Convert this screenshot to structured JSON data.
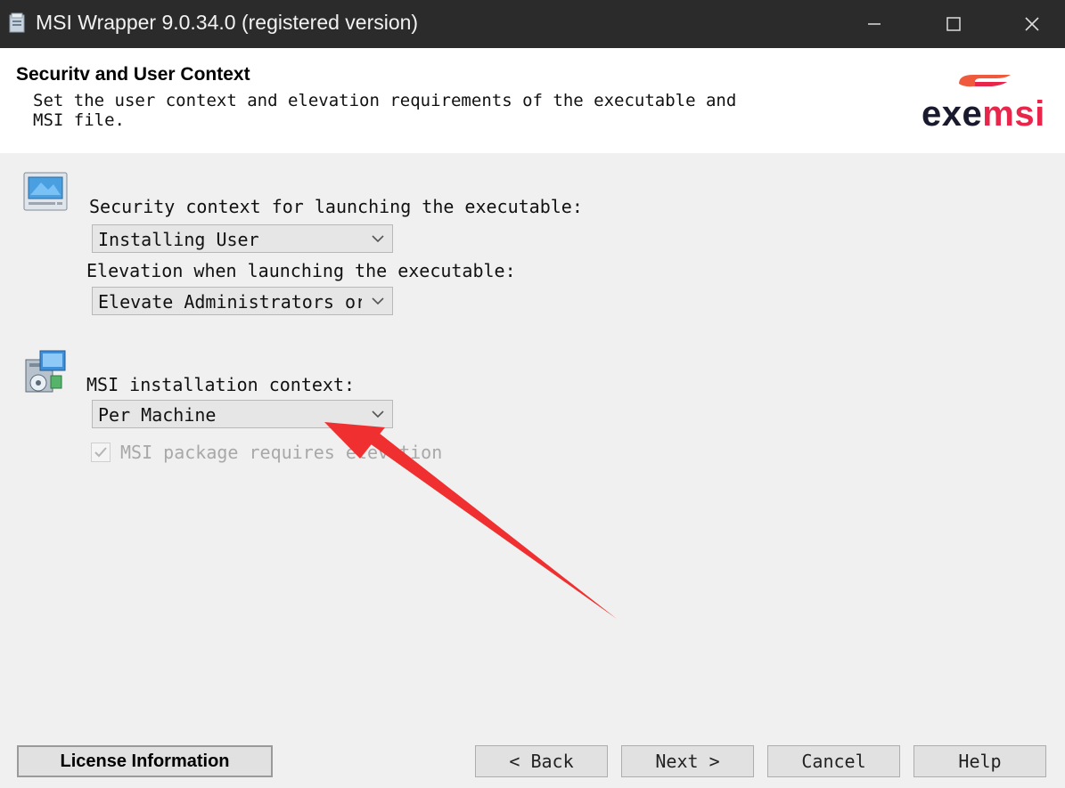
{
  "window": {
    "title": "MSI Wrapper 9.0.34.0 (registered version)",
    "controls": [
      "minimize",
      "maximize",
      "close"
    ]
  },
  "header": {
    "title": "Securitv and User Context",
    "description_line1": "Set the user context and elevation requirements of the executable and",
    "description_line2": "MSI file.",
    "logo_part1": "exe",
    "logo_part2": "msi",
    "logo_colors": {
      "exe": "#1a1a2e",
      "msi": "#e8264b",
      "swoosh": "#ef5a3c"
    }
  },
  "security": {
    "icon": "monitor-icon",
    "context_label": "Security context for launching the executable:",
    "context_value": "Installing User",
    "elevation_label": "Elevation when launching the executable:",
    "elevation_value": "Elevate Administrators or"
  },
  "msi": {
    "icon": "installer-package-icon",
    "context_label": "MSI installation context:",
    "context_value": "Per Machine",
    "requires_elevation_label": "MSI package requires elevation",
    "requires_elevation_checked": true,
    "requires_elevation_disabled": true
  },
  "annotation": {
    "type": "red-arrow",
    "color": "#f03030"
  },
  "buttons": {
    "license": "License Information",
    "back": "< Back",
    "next": "Next >",
    "cancel": "Cancel",
    "help": "Help"
  }
}
